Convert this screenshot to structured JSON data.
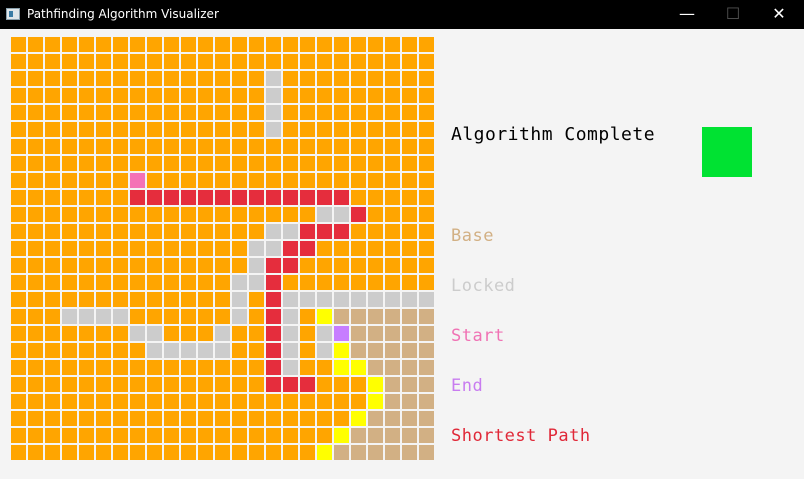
{
  "window": {
    "title": "Pathfinding Algorithm Visualizer"
  },
  "controls": {
    "minimize": "—",
    "maximize": "☐",
    "close": "✕"
  },
  "status": {
    "label": "Algorithm Complete",
    "color": "#00e232"
  },
  "legend": [
    {
      "label": "Base",
      "color": "#d2b084"
    },
    {
      "label": "Locked",
      "color": "#cccccc"
    },
    {
      "label": "Start",
      "color": "#f072b4"
    },
    {
      "label": "End",
      "color": "#c87cf0"
    },
    {
      "label": "Shortest Path",
      "color": "#e02838"
    }
  ],
  "palette": {
    "O": "#ffa500",
    "G": "#cccccc",
    "R": "#e52d3d",
    "Y": "#ffff00",
    "B": "#d2b084",
    "P": "#f472b6",
    "V": "#c77dff"
  },
  "grid": {
    "rows": 25,
    "cols": 25,
    "cells": [
      "OOOOOOOOOOOOOOOOOOOOOOOOO",
      "OOOOOOOOOOOOOOOOOOOOOOOOO",
      "OOOOOOOOOOOOOOOGOOOOOOOOO",
      "OOOOOOOOOOOOOOOGOOOOOOOOO",
      "OOOOOOOOOOOOOOOGOOOOOOOOO",
      "OOOOOOOOOOOOOOOGOOOOOOOOO",
      "OOOOOOOOOOOOOOOOOOOOOOOOO",
      "OOOOOOOOOOOOOOOOOOOOOOOOO",
      "OOOOOOOPOOOOOOOOOOOOOOOOO",
      "OOOOOOORRRRRRRRRRRRROOOOO",
      "OOOOOOOOOOOOOOOOOOGGROOOO",
      "OOOOOOOOOOOOOOOGGRRROOOOO",
      "OOOOOOOOOOOOOOGGRROOOOOOO",
      "OOOOOOOOOOOOOOGRROOOOOOOO",
      "OOOOOOOOOOOOOGGROOOOOOOOO",
      "OOOOOOOOOOOOOGORGGGGGGGGG",
      "OOOGGGGOOOOOOGORGOYBBBBBB",
      "OOOOOOOGGOOOGOORGOGVBBBBB",
      "OOOOOOOOGGGGGOORGOGYBBBBB",
      "OOOOOOOOOOOOOOORGOOYYBBBB",
      "OOOOOOOOOOOOOOORRROOOYBBB",
      "OOOOOOOOOOOOOOOOOOOOOYBBB",
      "OOOOOOOOOOOOOOOOOOOOYBBBB",
      "OOOOOOOOOOOOOOOOOOOYBBBBB",
      "OOOOOOOOOOOOOOOOOOYBBBBBB"
    ]
  }
}
